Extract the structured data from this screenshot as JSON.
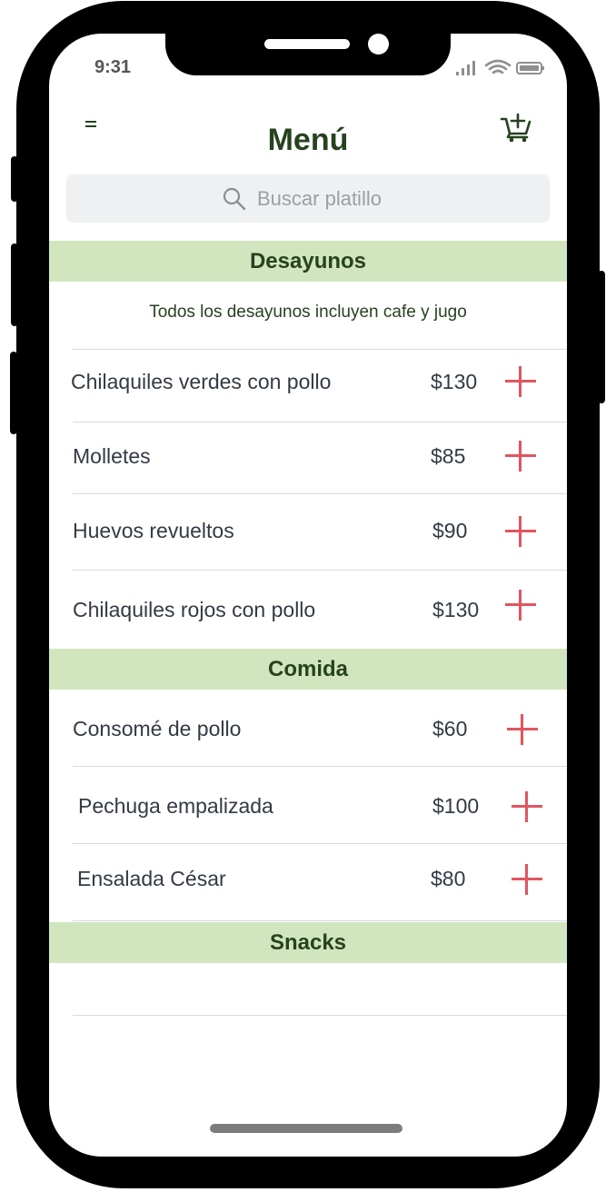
{
  "status_bar": {
    "time": "9:31"
  },
  "header": {
    "title": "Menú",
    "menu_icon": "hamburger-icon",
    "cart_icon": "add-to-cart-icon"
  },
  "search": {
    "placeholder": "Buscar platillo",
    "icon": "search-icon"
  },
  "sections": [
    {
      "title": "Desayunos",
      "note": "Todos los desayunos incluyen cafe y jugo",
      "items": [
        {
          "name": "Chilaquiles verdes con pollo",
          "price": "$130"
        },
        {
          "name": "Molletes",
          "price": "$85"
        },
        {
          "name": "Huevos revueltos",
          "price": "$90"
        },
        {
          "name": "Chilaquiles rojos con pollo",
          "price": "$130"
        }
      ]
    },
    {
      "title": "Comida",
      "items": [
        {
          "name": "Consomé de pollo",
          "price": "$60"
        },
        {
          "name": "Pechuga empalizada",
          "price": "$100"
        },
        {
          "name": "Ensalada César",
          "price": "$80"
        }
      ]
    },
    {
      "title": "Snacks",
      "items": []
    }
  ],
  "colors": {
    "accent_green": "#26421f",
    "section_bg": "#d1e6bf",
    "add_red": "#e0555f",
    "search_bg": "#eef0f2"
  }
}
